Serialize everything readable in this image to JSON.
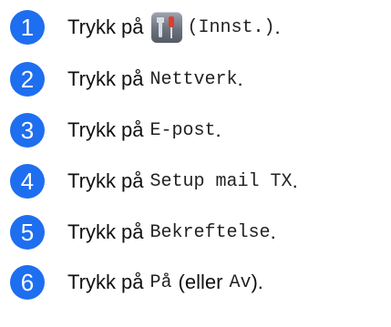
{
  "steps": [
    {
      "number": "1",
      "before": "Trykk på",
      "icon": "settings-tools-icon",
      "code": "(Innst.)",
      "after": "."
    },
    {
      "number": "2",
      "before": "Trykk på",
      "code": "Nettverk",
      "after": "."
    },
    {
      "number": "3",
      "before": "Trykk på",
      "code": "E-post",
      "after": "."
    },
    {
      "number": "4",
      "before": "Trykk på",
      "code": "Setup mail TX",
      "after": "."
    },
    {
      "number": "5",
      "before": "Trykk på",
      "code": "Bekreftelse",
      "after": "."
    },
    {
      "number": "6",
      "before": "Trykk på",
      "code": "På",
      "mid": "(eller",
      "code2": "Av",
      "after": ")."
    }
  ],
  "colors": {
    "step_circle": "#1e6ef0",
    "icon_bg": "#6c737e",
    "icon_accent": "#e23b2e"
  }
}
